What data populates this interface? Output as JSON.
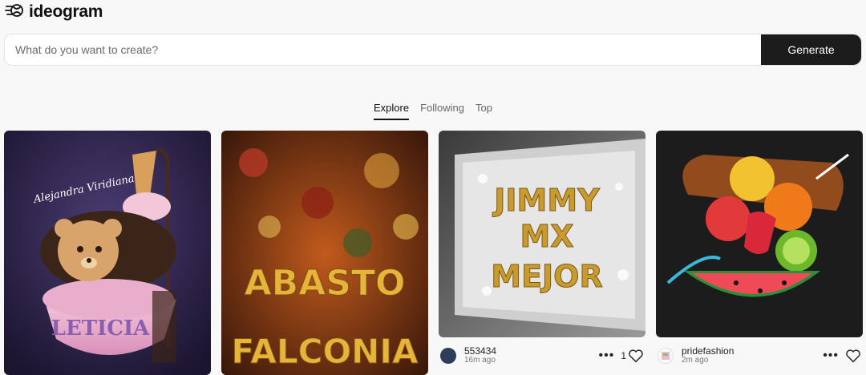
{
  "app": {
    "name": "ideogram",
    "logo_icon": "ideogram-logo-icon"
  },
  "search": {
    "placeholder": "What do you want to create?",
    "value": ""
  },
  "generate_label": "Generate",
  "tabs": [
    {
      "label": "Explore",
      "active": true
    },
    {
      "label": "Following",
      "active": false
    },
    {
      "label": "Top",
      "active": false
    }
  ],
  "cards": [
    {
      "image_text_top": "Alejandra Viridiana",
      "image_text_main": "LETICIA"
    },
    {
      "image_text_line1": "ABASTO",
      "image_text_line2": "FALCONIA"
    },
    {
      "image_text_line1": "JIMMY",
      "image_text_line2": "MX",
      "image_text_line3": "MEJOR",
      "username": "553434",
      "time": "16m ago",
      "likes": "1"
    },
    {
      "username": "pridefashion",
      "time": "2m ago"
    }
  ],
  "colors": {
    "accent": "#1c1c1c",
    "background": "#f8f8f8"
  }
}
